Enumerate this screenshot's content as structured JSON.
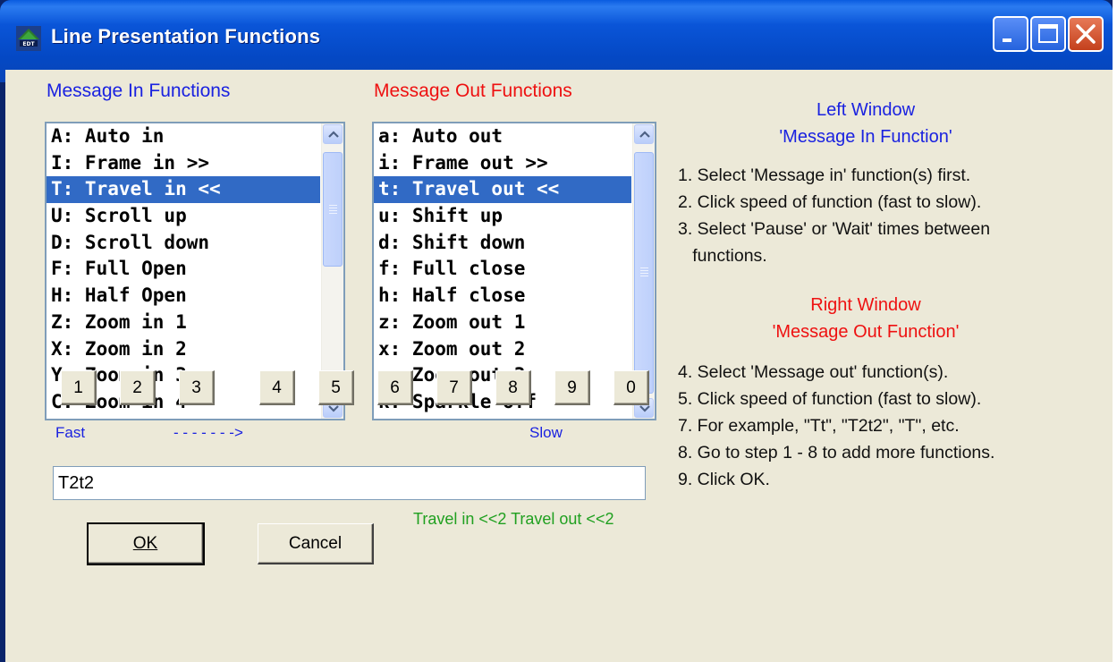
{
  "window": {
    "title": "Line Presentation Functions",
    "icon_label": "EDT"
  },
  "left_list": {
    "header": "Message In Functions",
    "items": [
      "A: Auto in",
      "I: Frame in >>",
      "T: Travel in <<",
      "U: Scroll up",
      "D: Scroll down",
      "F: Full Open",
      "H: Half Open",
      "Z: Zoom in 1",
      "X: Zoom in 2",
      "Y: Zoom in 3",
      "C: Zoom in 4"
    ],
    "selected": "T: Travel in <<"
  },
  "right_list": {
    "header": "Message Out Functions",
    "items": [
      "a: Auto out",
      "i: Frame out >>",
      "t: Travel out <<",
      "u: Shift up",
      "d: Shift down",
      "f: Full close",
      "h: Half close",
      "z: Zoom out 1",
      "x: Zoom out 2",
      "y: Zoom out 3",
      "k: Sparkle off"
    ],
    "selected": "t: Travel out <<"
  },
  "speed": {
    "fast_label": "Fast",
    "arrow_label": "- - - - - - ->",
    "slow_label": "Slow",
    "buttons": [
      "1",
      "2",
      "3",
      "4",
      "5",
      "6",
      "7",
      "8",
      "9",
      "0"
    ]
  },
  "code_input": {
    "value": "T2t2"
  },
  "summary_text": "Travel in <<2  Travel out <<2",
  "buttons": {
    "ok": "OK",
    "cancel": "Cancel"
  },
  "instructions": {
    "left_title_1": "Left Window",
    "left_title_2": "'Message In Function'",
    "left_steps": [
      "1. Select 'Message in' function(s) first.",
      "2. Click speed of function (fast to slow).",
      "3. Select 'Pause' or 'Wait' times between",
      "   functions."
    ],
    "right_title_1": "Right Window",
    "right_title_2": "'Message Out Function'",
    "right_steps": [
      "4. Select 'Message out' function(s).",
      "5. Click speed of function (fast to slow).",
      "7. For example, \"Tt\", \"T2t2\", \"T\", etc.",
      "8. Go to step 1 - 8 to add more functions.",
      "9. Click OK."
    ]
  },
  "colors": {
    "title_bar": "#0a55d8",
    "selection": "#316ac5",
    "in_header": "#1a22e0",
    "out_header": "#ee1111",
    "summary": "#20a020",
    "dialog_bg": "#ece9d8"
  }
}
